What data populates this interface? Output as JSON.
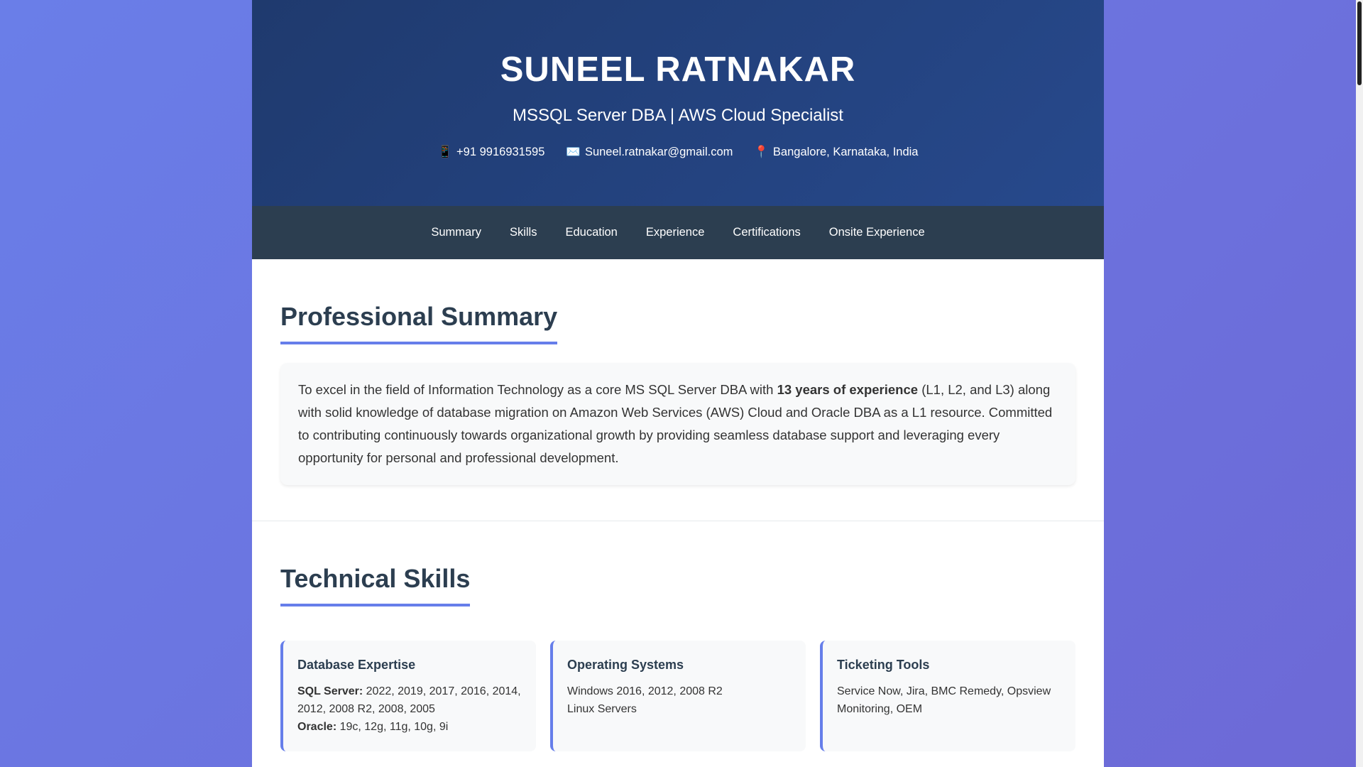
{
  "header": {
    "name": "SUNEEL RATNAKAR",
    "subtitle": "MSSQL Server DBA | AWS Cloud Specialist",
    "contacts": [
      {
        "icon": "📱",
        "text": "+91 9916931595"
      },
      {
        "icon": "✉️",
        "text": "Suneel.ratnakar@gmail.com"
      },
      {
        "icon": "📍",
        "text": "Bangalore, Karnataka, India"
      }
    ]
  },
  "nav": [
    "Summary",
    "Skills",
    "Education",
    "Experience",
    "Certifications",
    "Onsite Experience"
  ],
  "summary": {
    "title": "Professional Summary",
    "before": "To excel in the field of Information Technology as a core MS SQL Server DBA with ",
    "bold": "13 years of experience",
    "after": " (L1, L2, and L3) along with solid knowledge of database migration on Amazon Web Services (AWS) Cloud and Oracle DBA as a L1 resource. Committed to contributing continuously towards organizational growth by providing seamless database support and leveraging every opportunity for personal and professional development."
  },
  "skills": {
    "title": "Technical Skills",
    "cards": [
      {
        "title": "Database Expertise",
        "l1": "SQL Server:",
        "v1": " 2022, 2019, 2017, 2016, 2014, 2012, 2008 R2, 2008, 2005",
        "l2": "Oracle:",
        "v2": " 19c, 12g, 11g, 10g, 9i"
      },
      {
        "title": "Operating Systems",
        "line1": "Windows 2016, 2012, 2008 R2",
        "line2": "Linux Servers"
      },
      {
        "title": "Ticketing Tools",
        "line1": "Service Now, Jira, BMC Remedy, Opsview Monitoring, OEM"
      }
    ]
  }
}
